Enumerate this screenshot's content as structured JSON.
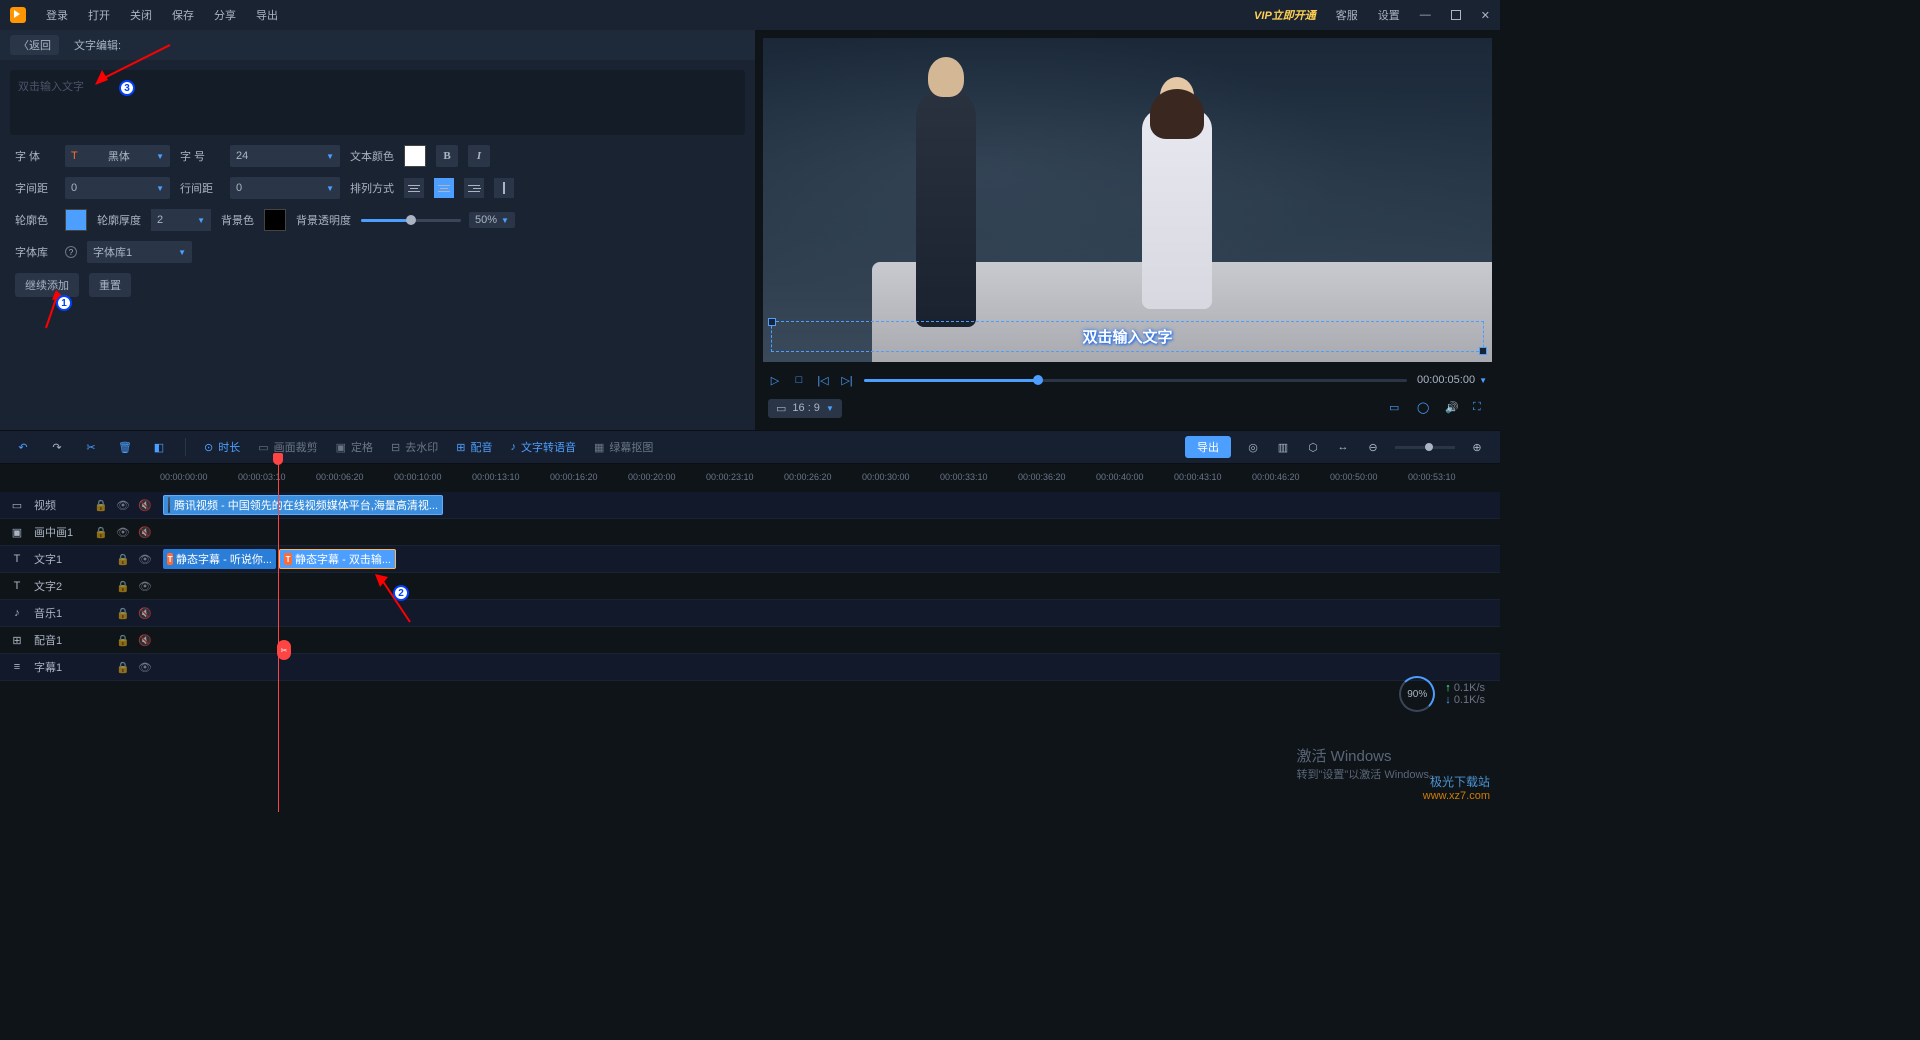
{
  "menu": {
    "login": "登录",
    "open": "打开",
    "close": "关闭",
    "save": "保存",
    "share": "分享",
    "export": "导出",
    "vip": "VIP立即开通",
    "service": "客服",
    "settings": "设置"
  },
  "panel": {
    "back": "〈返回",
    "title": "文字编辑:",
    "placeholder": "双击输入文字"
  },
  "form": {
    "font_lbl": "字 体",
    "font_val": "黑体",
    "size_lbl": "字 号",
    "size_val": "24",
    "color_lbl": "文本颜色",
    "letter_lbl": "字间距",
    "letter_val": "0",
    "line_lbl": "行间距",
    "line_val": "0",
    "align_lbl": "排列方式",
    "outline_color_lbl": "轮廓色",
    "outline_w_lbl": "轮廓厚度",
    "outline_w_val": "2",
    "bg_lbl": "背景色",
    "bg_op_lbl": "背景透明度",
    "bg_op_val": "50%",
    "lib_lbl": "字体库",
    "lib_val": "字体库1",
    "add_btn": "继续添加",
    "reset_btn": "重置"
  },
  "preview": {
    "overlay": "双击输入文字",
    "time": "00:00:05:00",
    "ratio": "16 : 9"
  },
  "toolbar": {
    "duration": "时长",
    "crop": "画面裁剪",
    "freeze": "定格",
    "watermark": "去水印",
    "dub": "配音",
    "tts": "文字转语音",
    "green": "绿幕抠图",
    "export": "导出"
  },
  "ruler": [
    "00:00:00:00",
    "00:00:03:10",
    "00:00:06:20",
    "00:00:10:00",
    "00:00:13:10",
    "00:00:16:20",
    "00:00:20:00",
    "00:00:23:10",
    "00:00:26:20",
    "00:00:30:00",
    "00:00:33:10",
    "00:00:36:20",
    "00:00:40:00",
    "00:00:43:10",
    "00:00:46:20",
    "00:00:50:00",
    "00:00:53:10"
  ],
  "tracks": {
    "video": "视频",
    "pip": "画中画1",
    "text1": "文字1",
    "text2": "文字2",
    "music": "音乐1",
    "dub": "配音1",
    "sub": "字幕1"
  },
  "clips": {
    "video": "腾讯视频 - 中国领先的在线视频媒体平台,海量高清视...",
    "t1": "静态字幕 - 听说你...",
    "t2": "静态字幕 - 双击输..."
  },
  "perf": {
    "pct": "90%",
    "up": "0.1K/s",
    "down": "0.1K/s"
  },
  "activate": {
    "l1": "激活 Windows",
    "l2": "转到\"设置\"以激活 Windows。"
  },
  "watermark": {
    "l1": "极光下载站",
    "l2": "www.xz7.com"
  },
  "annotations": {
    "a1": "1",
    "a2": "2",
    "a3": "3"
  }
}
